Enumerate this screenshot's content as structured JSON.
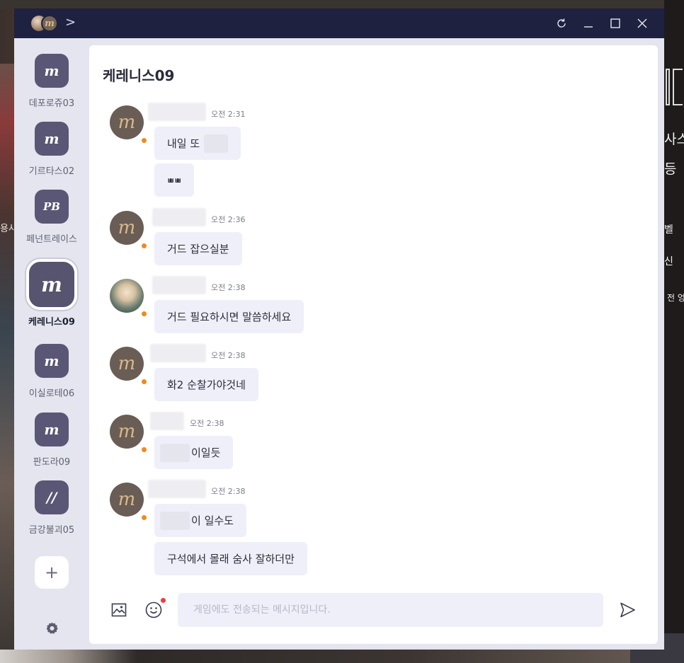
{
  "window": {
    "controls": {
      "refresh": "C",
      "minimize": "_",
      "maximize": "☐",
      "close": "✕"
    },
    "chevron": ">",
    "brand_glyph": "m"
  },
  "background": {
    "left_text": "용사",
    "right_texts": [
      "사스",
      "등",
      "벨",
      "신",
      "전 엉"
    ]
  },
  "sidebar": {
    "servers": [
      {
        "label": "데포로쥬03",
        "glyph": "m",
        "active": false
      },
      {
        "label": "기르타스02",
        "glyph": "m",
        "active": false
      },
      {
        "label": "페넌트레이스",
        "glyph": "PB",
        "active": false
      },
      {
        "label": "케레니스09",
        "glyph": "m",
        "active": true
      },
      {
        "label": "이실로테06",
        "glyph": "m",
        "active": false
      },
      {
        "label": "판도라09",
        "glyph": "m",
        "active": false
      },
      {
        "label": "금강불괴05",
        "glyph": "//",
        "active": false
      }
    ],
    "add_label": "+"
  },
  "chat": {
    "title": "케레니스09",
    "messages": [
      {
        "time": "오전 2:31",
        "bubbles": [
          "내일 또",
          "ㅃㅃ"
        ]
      },
      {
        "time": "오전 2:36",
        "bubbles": [
          "거드 잡으실분"
        ]
      },
      {
        "time": "오전 2:38",
        "bubbles": [
          "거드 필요하시면 말씀하세요"
        ]
      },
      {
        "time": "오전 2:38",
        "bubbles": [
          "화2 순찰가야것네"
        ]
      },
      {
        "time": "오전 2:38",
        "bubbles": [
          "이일듯"
        ]
      },
      {
        "time": "오전 2:38",
        "bubbles": [
          "이 일수도",
          "구석에서 몰래 숨사 잘하더만"
        ]
      }
    ],
    "input": {
      "placeholder": "게임에도 전송되는 메시지입니다.",
      "value": ""
    }
  },
  "colors": {
    "titlebar": "#1f2140",
    "server_icon": "#5a5675",
    "bubble": "#efeff9",
    "status_dot": "#f08a1c",
    "notify_dot": "#ee3d3d"
  }
}
